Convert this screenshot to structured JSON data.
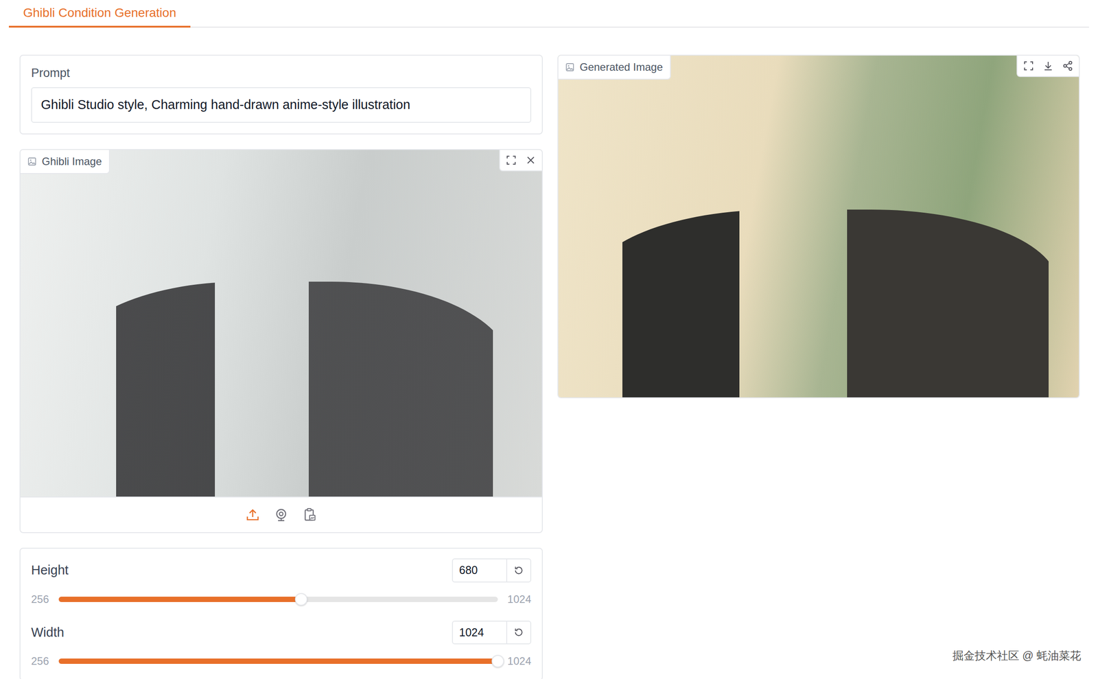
{
  "tabs": [
    {
      "label": "Ghibli Condition Generation",
      "selected": true
    }
  ],
  "prompt": {
    "label": "Prompt",
    "value": "Ghibli Studio style, Charming hand-drawn anime-style illustration"
  },
  "input_image": {
    "label": "Ghibli Image"
  },
  "sliders": [
    {
      "label": "Height",
      "value": "680",
      "min": "256",
      "max": "1024",
      "level": 0.552
    },
    {
      "label": "Width",
      "value": "1024",
      "min": "256",
      "max": "1024",
      "level": 1
    }
  ],
  "output_image": {
    "label": "Generated Image"
  },
  "watermark": "掘金技术社区 @ 蚝油菜花"
}
